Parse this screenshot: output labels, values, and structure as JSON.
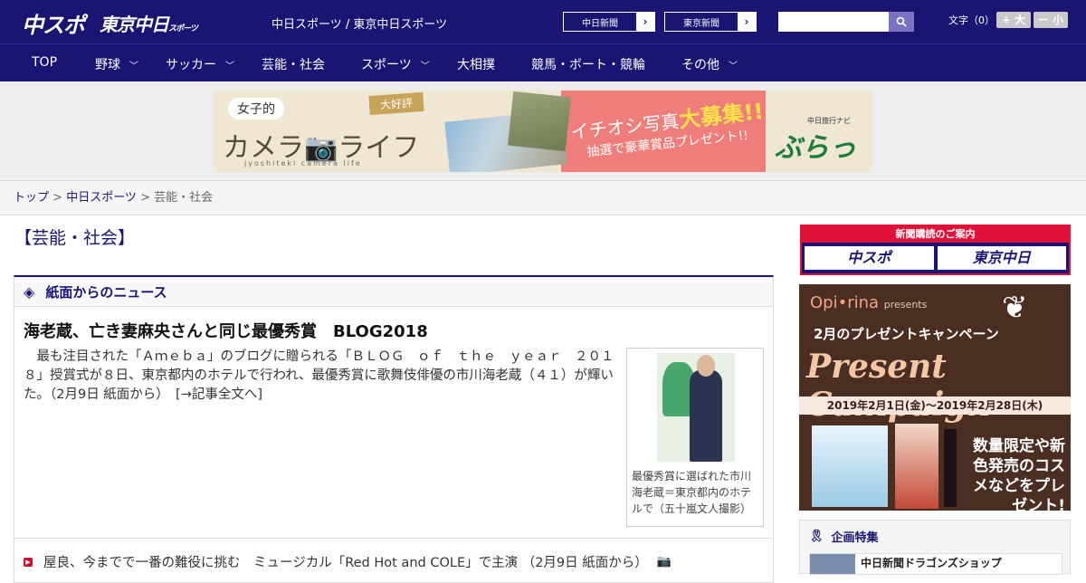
{
  "header": {
    "logo_chunichi_sports": "中スポ",
    "logo_tokyo_chunichi": "東京中日",
    "logo_tokyo_suffix": "スポーツ",
    "site_name": "中日スポーツ / 東京中日スポーツ",
    "ext_links": [
      {
        "label": "中日新聞"
      },
      {
        "label": "東京新聞"
      }
    ],
    "search_placeholder": "",
    "font_size_label": "文字（0）",
    "font_larger": "+ 大",
    "font_smaller": "ー 小"
  },
  "nav": {
    "items": [
      {
        "label": "TOP",
        "has_dropdown": false
      },
      {
        "label": "野球",
        "has_dropdown": true
      },
      {
        "label": "サッカー",
        "has_dropdown": true
      },
      {
        "label": "芸能・社会",
        "has_dropdown": false
      },
      {
        "label": "スポーツ",
        "has_dropdown": true
      },
      {
        "label": "大相撲",
        "has_dropdown": false
      },
      {
        "label": "競馬・ボート・競輪",
        "has_dropdown": false
      },
      {
        "label": "その他",
        "has_dropdown": true
      }
    ]
  },
  "banner": {
    "tag1": "女子的",
    "tag2": "大好評",
    "title": "カメラ📷ライフ",
    "subtitle": "jyoshiteki camera life",
    "promo1": "イチオシ写真",
    "promo1_highlight": "大募集!!",
    "promo2": "抽選で豪華賞品プレゼント!!",
    "brand_small": "中日旅行ナビ",
    "brand": "ぶらっ人"
  },
  "breadcrumb": {
    "items": [
      "トップ",
      "中日スポーツ"
    ],
    "separator": " > ",
    "current": "芸能・社会"
  },
  "main": {
    "section_title": "【芸能・社会】",
    "news_box_title": "紙面からのニュース",
    "headline": "海老蔵、亡き妻麻央さんと同じ最優秀賞　BLOG2018",
    "body": "　最も注目された「Ａｍｅｂａ」のブログに贈られる「ＢＬＯＧ　ｏｆ　ｔｈｅ　ｙｅａｒ　２０１８」授賞式が８日、東京都内のホテルで行われ、最優秀賞に歌舞伎俳優の市川海老蔵（４１）が輝いた。（2月9日 紙面から）　[→記事全文へ]",
    "photo_caption": "最優秀賞に選ばれた市川海老蔵＝東京都内のホテルで（五十嵐文人撮影）",
    "news_items": [
      {
        "text": "屋良、今までで一番の難役に挑む　ミュージカル「Red Hot and COLE」で主演 （2月9日 紙面から）",
        "has_photo": true
      }
    ]
  },
  "sidebar": {
    "subscribe_title": "新聞購読のご案内",
    "subscribe_buttons": [
      "中スポ",
      "東京中日"
    ],
    "ad": {
      "brand": "Opi•rina",
      "brand_suffix": "presents",
      "line1": "2月のプレゼントキャンペーン",
      "line2": "Present Campaign",
      "dates": "2019年2月1日(金)～2019年2月28日(木)",
      "right_text": "数量限定や新色発売のコスメなどをプレゼント!"
    },
    "feature_title": "企画特集",
    "feature_item": "中日新聞ドラゴンズショップ"
  },
  "colors": {
    "brand_navy": "#1a1573",
    "accent_red": "#e0123a"
  }
}
